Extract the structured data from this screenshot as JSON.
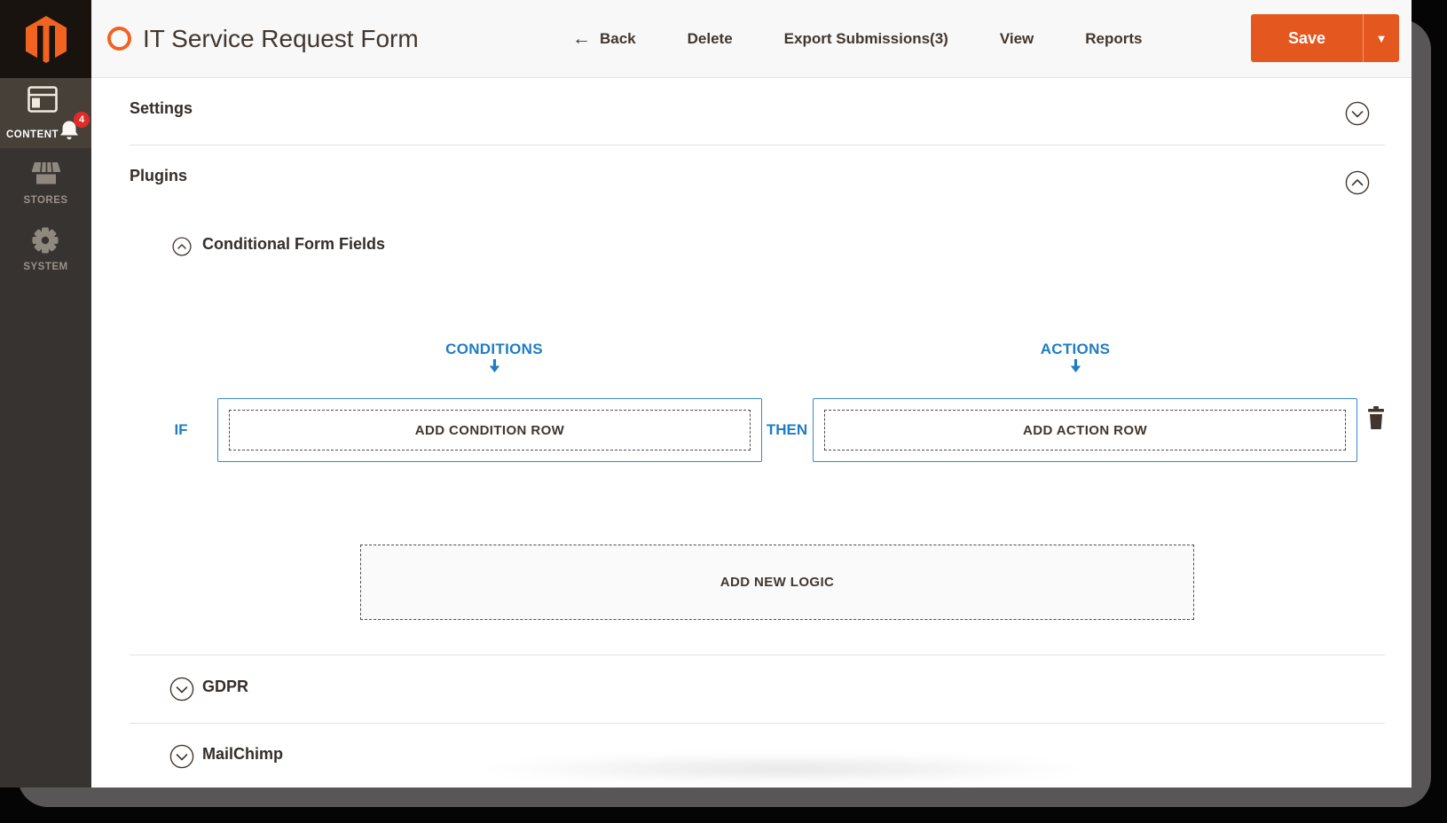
{
  "sidebar": {
    "logo": "magento-logo",
    "notification_badge": "4",
    "items": [
      {
        "label": "CONTENT",
        "icon": "content-layout-icon",
        "active": true
      },
      {
        "label": "STORES",
        "icon": "storefront-icon",
        "active": false
      },
      {
        "label": "SYSTEM",
        "icon": "gear-icon",
        "active": false
      }
    ]
  },
  "header": {
    "form_icon": "orange-ring-icon",
    "title": "IT Service Request Form",
    "nav": [
      {
        "label": "Back",
        "icon": "back-arrow-icon"
      },
      {
        "label": "Delete"
      },
      {
        "label": "Export Submissions(3)"
      },
      {
        "label": "View"
      },
      {
        "label": "Reports"
      }
    ],
    "save": {
      "label": "Save",
      "caret": "▼"
    }
  },
  "icons": {
    "back_arrow": "←"
  },
  "accordions": {
    "settings": {
      "label": "Settings",
      "state": "collapsed"
    },
    "plugins": {
      "label": "Plugins",
      "state": "expanded"
    }
  },
  "plugins": {
    "conditional_form_fields": {
      "title": "Conditional Form Fields",
      "state": "expanded",
      "conditions_header": "CONDITIONS",
      "actions_header": "ACTIONS",
      "if_label": "IF",
      "then_label": "THEN",
      "add_condition_row": "ADD CONDITION ROW",
      "add_action_row": "ADD ACTION ROW",
      "add_new_logic": "ADD NEW LOGIC"
    },
    "gdpr": {
      "title": "GDPR",
      "state": "collapsed"
    },
    "mailchimp": {
      "title": "MailChimp",
      "state": "collapsed"
    }
  },
  "colors": {
    "accent_orange": "#e4571f",
    "logo_orange": "#f26322",
    "link_blue": "#1f7dc2",
    "badge_red": "#e02b27",
    "sidebar_bg": "#373330",
    "sidebar_active_bg": "#474039",
    "header_bg": "#f8f8f8",
    "text_dark": "#41362f"
  }
}
